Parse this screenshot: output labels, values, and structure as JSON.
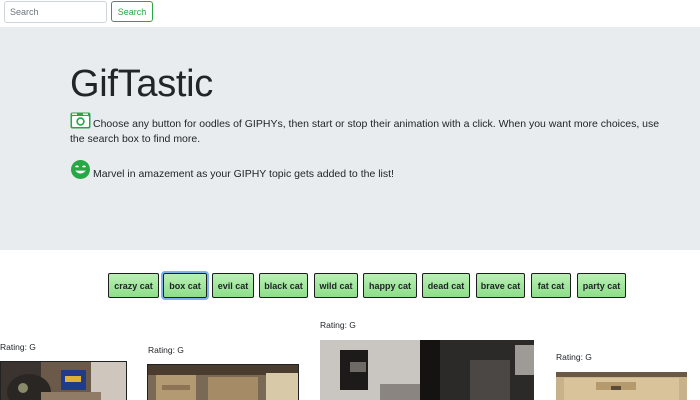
{
  "search": {
    "placeholder": "Search",
    "value": "",
    "button_label": "Search"
  },
  "header": {
    "title": "GifTastic",
    "lead_1": "Choose any button for oodles of GIPHYs, then start or stop their animation with a click. When you want more choices, use the search box to find more.",
    "lead_2": "Marvel in amazement as your GIPHY topic gets added to the list!",
    "icon_1": "camera-icon",
    "icon_2": "smile-icon",
    "accent_color": "#28a745"
  },
  "topics": [
    "crazy cat",
    "box cat",
    "evil cat",
    "black cat",
    "wild cat",
    "happy cat",
    "dead cat",
    "brave cat",
    "fat cat",
    "party cat"
  ],
  "active_topic": "box cat",
  "gifs": [
    {
      "rating": "Rating: G"
    },
    {
      "rating": "Rating: G"
    },
    {
      "rating": "Rating: G"
    },
    {
      "rating": "Rating: G"
    }
  ]
}
